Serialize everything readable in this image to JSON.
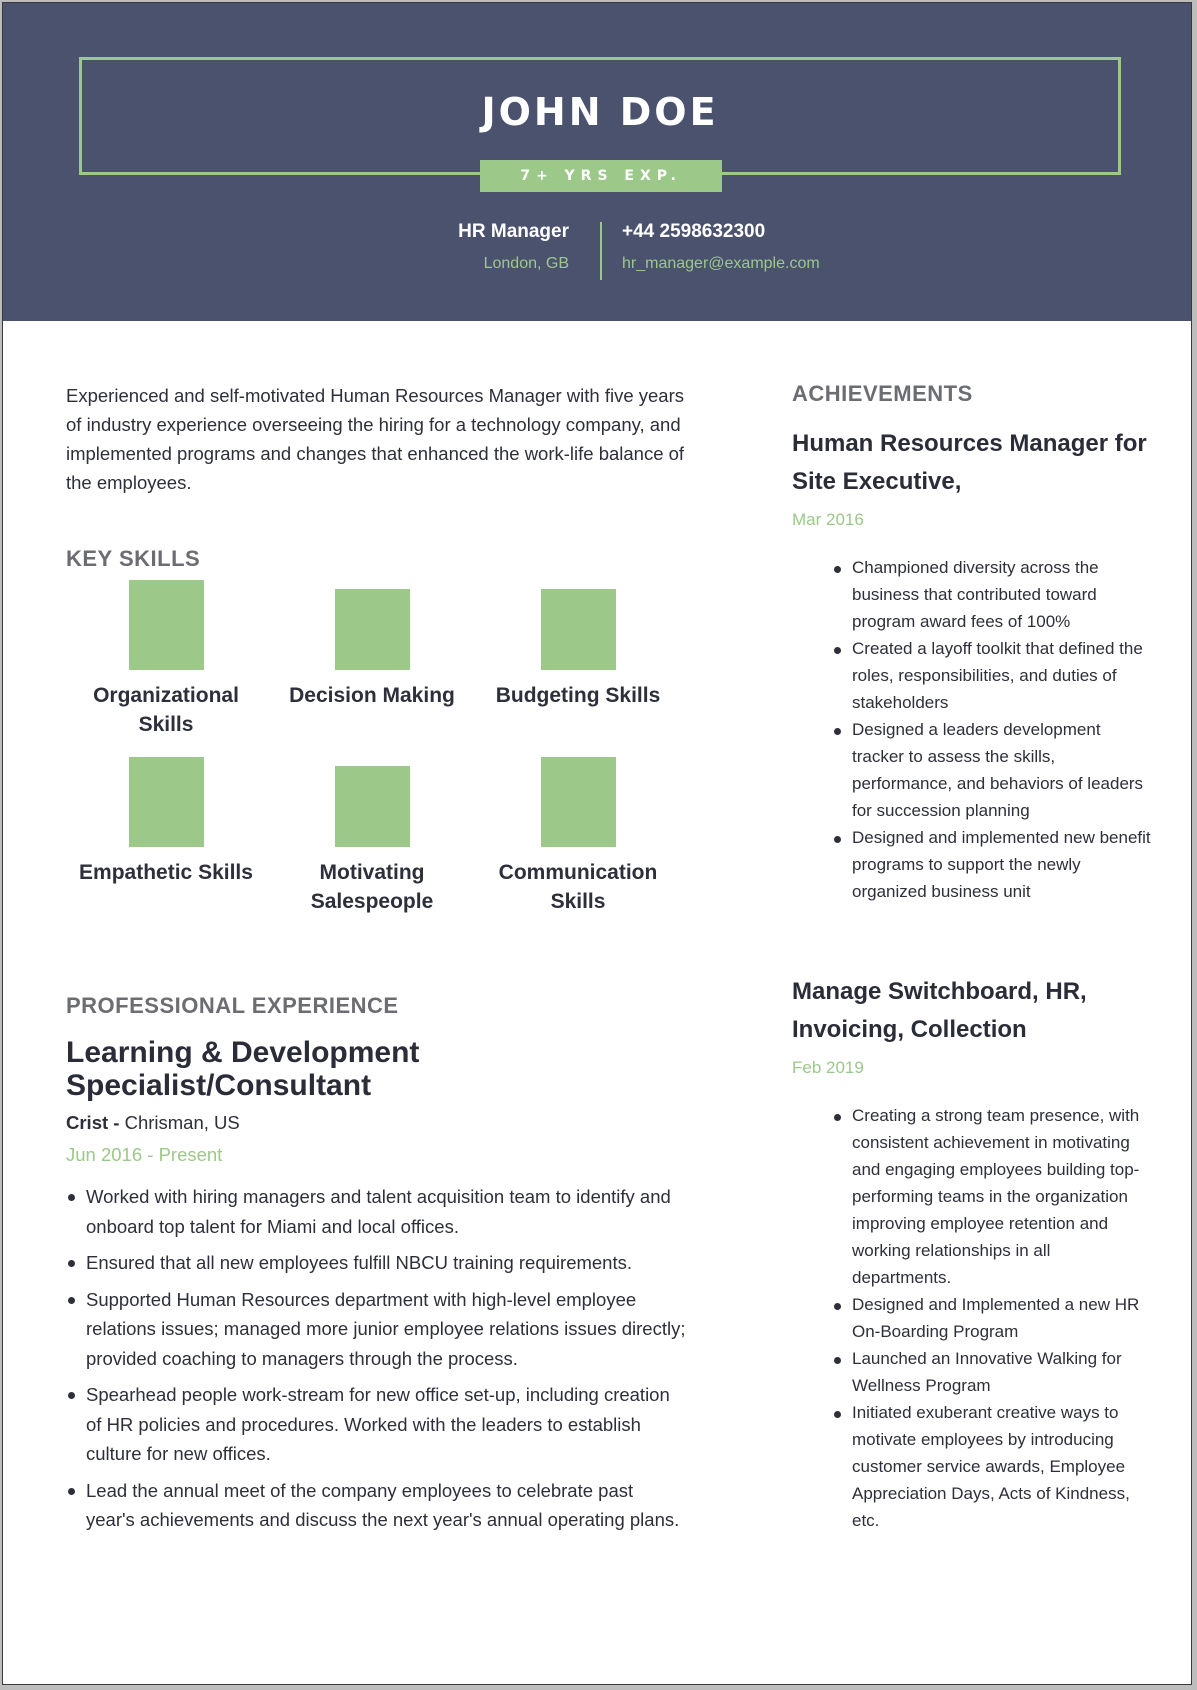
{
  "colors": {
    "header_bg": "#4b526e",
    "accent": "#9cc88a",
    "text_dark": "#2d2f3a",
    "section_title": "#6b6d72"
  },
  "header": {
    "name": "JOHN DOE",
    "experience_badge": "7+ YRS EXP.",
    "job_title": "HR Manager",
    "location": "London, GB",
    "phone": "+44 2598632300",
    "email": "hr_manager@example.com"
  },
  "summary": "Experienced and self-motivated Human Resources Manager with five years of industry experience overseeing the hiring for a technology company, and implemented programs and changes that enhanced the work-life balance of the employees.",
  "key_skills": {
    "title": "KEY SKILLS",
    "items": [
      {
        "label": "Organizational Skills",
        "level": 1.0
      },
      {
        "label": "Decision Making",
        "level": 0.9
      },
      {
        "label": "Budgeting Skills",
        "level": 0.9
      },
      {
        "label": "Empathetic Skills",
        "level": 1.0
      },
      {
        "label": "Motivating Salespeople",
        "level": 0.9
      },
      {
        "label": "Communication Skills",
        "level": 1.0
      }
    ]
  },
  "experience": {
    "title": "PROFESSIONAL EXPERIENCE",
    "jobs": [
      {
        "title": "Learning & Development Specialist/Consultant",
        "company": "Crist -",
        "location": "Chrisman, US",
        "dates": "Jun 2016 - Present",
        "bullets": [
          "Worked with hiring managers and talent acquisition team to identify and onboard top talent for Miami and local offices.",
          "Ensured that all new employees fulfill NBCU training requirements.",
          "Supported Human Resources department with high-level employee relations issues; managed more junior employee relations issues directly; provided coaching to managers through the process.",
          "Spearhead people work-stream for new office set-up, including creation of HR policies and procedures. Worked with the leaders to establish culture for new offices.",
          "Lead the annual meet of the company employees to celebrate past year's achievements and discuss the next year's annual operating plans."
        ]
      }
    ]
  },
  "achievements": {
    "title": "ACHIEVEMENTS",
    "items": [
      {
        "title": "Human Resources Manager for Site Executive,",
        "date": "Mar 2016",
        "bullets": [
          " Championed diversity across the business that contributed toward program award fees of 100%",
          "Created a layoff toolkit that defined the roles, responsibilities, and duties of stakeholders",
          "Designed a leaders development tracker to assess the skills, performance, and behaviors of leaders for succession planning",
          "Designed and implemented new benefit programs to support the newly organized business unit"
        ]
      },
      {
        "title": "Manage Switchboard, HR, Invoicing, Collection",
        "date": "Feb 2019",
        "bullets": [
          " Creating a strong team presence, with consistent achievement in motivating and engaging employees building top-performing teams in the organization improving employee retention and working relationships in all departments.",
          "Designed and Implemented a new HR On-Boarding Program",
          "Launched an Innovative Walking for Wellness Program",
          "Initiated exuberant creative ways to motivate employees by introducing customer service awards, Employee Appreciation Days, Acts of Kindness, etc."
        ]
      }
    ]
  }
}
